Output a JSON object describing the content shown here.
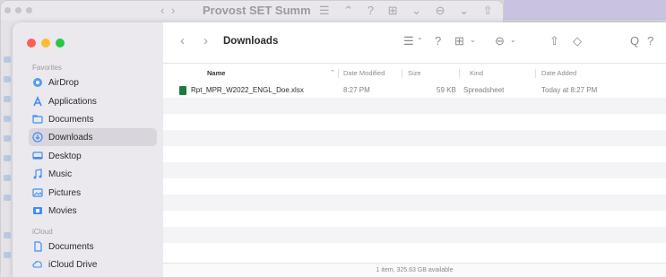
{
  "background_window": {
    "title": "Provost SET Summ",
    "toolbar_glyphs_left": "‹ ›",
    "toolbar_glyphs_right": "☰ ⌃ ? ⊞ ⌄ ⊖ ⌄ ⇧ »"
  },
  "window": {
    "title": "Downloads",
    "status": "1 item, 325.63 GB available"
  },
  "toolbar": {
    "back_icon": "‹",
    "forward_icon": "›",
    "list_view_icon": "☰",
    "sort_icon": "⌃",
    "help_icon": "?",
    "grid_icon": "⊞",
    "grid_chevron": "⌄",
    "action_icon": "⊖",
    "action_chevron": "⌄",
    "share_icon": "⇧",
    "tag_icon": "◇",
    "search_icon": "Q",
    "overflow_icon": "?"
  },
  "sidebar": {
    "favorites_header": "Favorites",
    "icloud_header": "iCloud",
    "favorites": [
      {
        "label": "AirDrop",
        "icon": "airdrop-icon"
      },
      {
        "label": "Applications",
        "icon": "applications-icon"
      },
      {
        "label": "Documents",
        "icon": "folder-icon"
      },
      {
        "label": "Downloads",
        "icon": "downloads-icon",
        "selected": true
      },
      {
        "label": "Desktop",
        "icon": "desktop-icon"
      },
      {
        "label": "Music",
        "icon": "music-icon"
      },
      {
        "label": "Pictures",
        "icon": "pictures-icon"
      },
      {
        "label": "Movies",
        "icon": "movies-icon"
      }
    ],
    "icloud": [
      {
        "label": "Documents",
        "icon": "document-icon"
      },
      {
        "label": "iCloud Drive",
        "icon": "cloud-icon"
      }
    ]
  },
  "columns": {
    "name": "Name",
    "date_modified": "Date Modified",
    "size": "Size",
    "kind": "Kind",
    "date_added": "Date Added"
  },
  "files": [
    {
      "name": "Rpt_MPR_W2022_ENGL_Doe.xlsx",
      "date_modified": "8:27 PM",
      "size": "59 KB",
      "kind": "Spreadsheet",
      "date_added": "Today at 8:27 PM"
    }
  ],
  "colors": {
    "accent": "#3e8ef7",
    "sidebar_bg": "#ebe8ee",
    "selected_bg": "#d8d6dc",
    "excel_green": "#1d7a43"
  }
}
